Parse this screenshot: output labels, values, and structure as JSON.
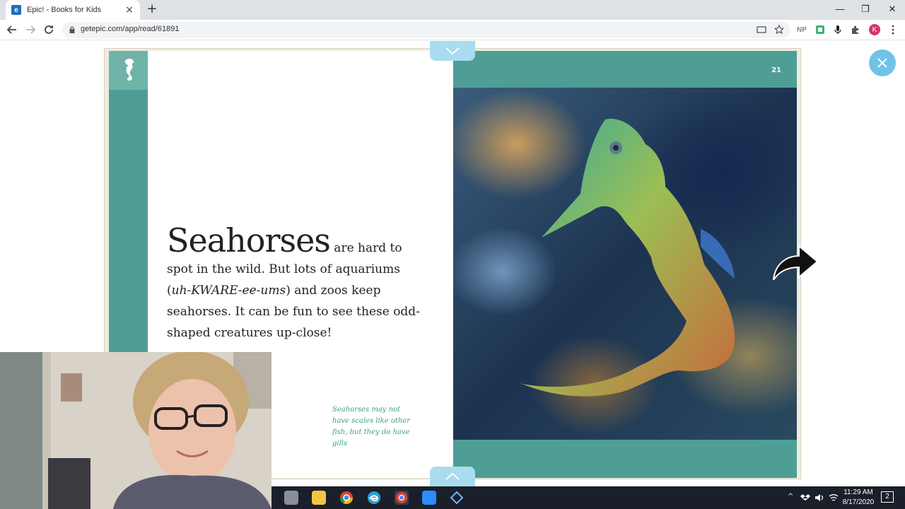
{
  "browser": {
    "tab_title": "Epic! - Books for Kids",
    "tab_close": "×",
    "new_tab": "+",
    "url": "getepic.com/app/read/61891",
    "ext_np": "NP",
    "profile_initial": "K",
    "window_controls": [
      "—",
      "❐",
      "✕"
    ]
  },
  "book": {
    "page_number": "21",
    "headline_word": "Seahorses",
    "main_text_rest": " are hard to spot in the wild. But lots of aquariums (",
    "main_text_italic": "uh-KWARE-ee-ums",
    "main_text_end": ") and zoos keep seahorses. It can be fun to see these odd-shaped creatures up-close!",
    "caption": "Seahorses may not have scales like other fish, but they do have gills"
  },
  "taskbar": {
    "time": "11:29 AM",
    "date": "8/17/2020",
    "notification_count": "2"
  },
  "colors": {
    "teal": "#4e9e95",
    "light_teal": "#6fb3a8",
    "caption_green": "#3f9b86",
    "epic_blue": "#6ec3e8"
  }
}
